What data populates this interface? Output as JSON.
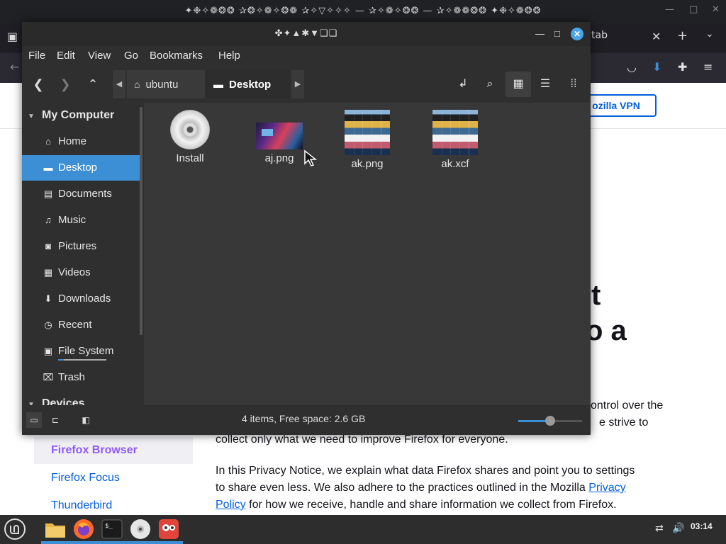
{
  "firefox": {
    "window_title": "✦❉✧❁❂❂ ✰❂✧❁✧❂❁ ✰✧▽✧✧✧ — ✰✧❁✧❂❂ — ✰✧❁❁❂❂ ✦❉✧❁❂❂",
    "tab_label": "tab",
    "vpn_button": "ozilla VPN",
    "heading_line1": "t",
    "heading_line2": "o a",
    "para1_line1": "ontrol over the",
    "para1_line2": "e strive to",
    "para1_line3": "collect only what we need to improve Firefox for everyone.",
    "para2_line1": "In this Privacy Notice, we explain what data Firefox shares and point you to settings",
    "para2_line2_pre": "to share even less. We also adhere to the practices outlined in the Mozilla ",
    "para2_link1": "Privacy",
    "para2_link2": "Policy",
    "para2_line3_post": " for how we receive, handle and share information we collect from Firefox.",
    "side_links": [
      "Firefox Browser",
      "Firefox Focus",
      "Thunderbird"
    ]
  },
  "nemo": {
    "title": "✤✦▲✱▼❏❏",
    "menu": [
      "File",
      "Edit",
      "View",
      "Go",
      "Bookmarks",
      "Help"
    ],
    "breadcrumbs": [
      {
        "label": "ubuntu",
        "icon": "home-icon"
      },
      {
        "label": "Desktop",
        "icon": "desktop-icon"
      }
    ],
    "sidebar": {
      "header_my_computer": "My Computer",
      "items": [
        {
          "label": "Home",
          "icon": "home-icon",
          "glyph": "⌂"
        },
        {
          "label": "Desktop",
          "icon": "desktop-icon",
          "glyph": "▬"
        },
        {
          "label": "Documents",
          "icon": "document-icon",
          "glyph": "▤"
        },
        {
          "label": "Music",
          "icon": "music-icon",
          "glyph": "♫"
        },
        {
          "label": "Pictures",
          "icon": "camera-icon",
          "glyph": "◙"
        },
        {
          "label": "Videos",
          "icon": "film-icon",
          "glyph": "▦"
        },
        {
          "label": "Downloads",
          "icon": "download-icon",
          "glyph": "⬇"
        },
        {
          "label": "Recent",
          "icon": "clock-icon",
          "glyph": "◷"
        },
        {
          "label": "File System",
          "icon": "drive-icon",
          "glyph": "▣"
        },
        {
          "label": "Trash",
          "icon": "trash-icon",
          "glyph": "🗑"
        }
      ],
      "header_devices": "Devices",
      "selected": "Desktop"
    },
    "files": [
      {
        "name": "Install",
        "type": "cd"
      },
      {
        "name": "aj.png",
        "type": "image-wide"
      },
      {
        "name": "ak.png",
        "type": "image-tall"
      },
      {
        "name": "ak.xcf",
        "type": "image-tall"
      }
    ],
    "status": "4 items, Free space: 2.6 GB",
    "zoom_level": 0.5
  },
  "taskbar": {
    "clock": "03:14",
    "apps": [
      "menu-icon",
      "files-icon",
      "firefox-icon",
      "terminal-icon",
      "cd-icon",
      "gimp-icon"
    ]
  },
  "colors": {
    "accent": "#3d8fd5",
    "firefox_link": "#0060df",
    "firefox_active_link": "#9059ff"
  }
}
